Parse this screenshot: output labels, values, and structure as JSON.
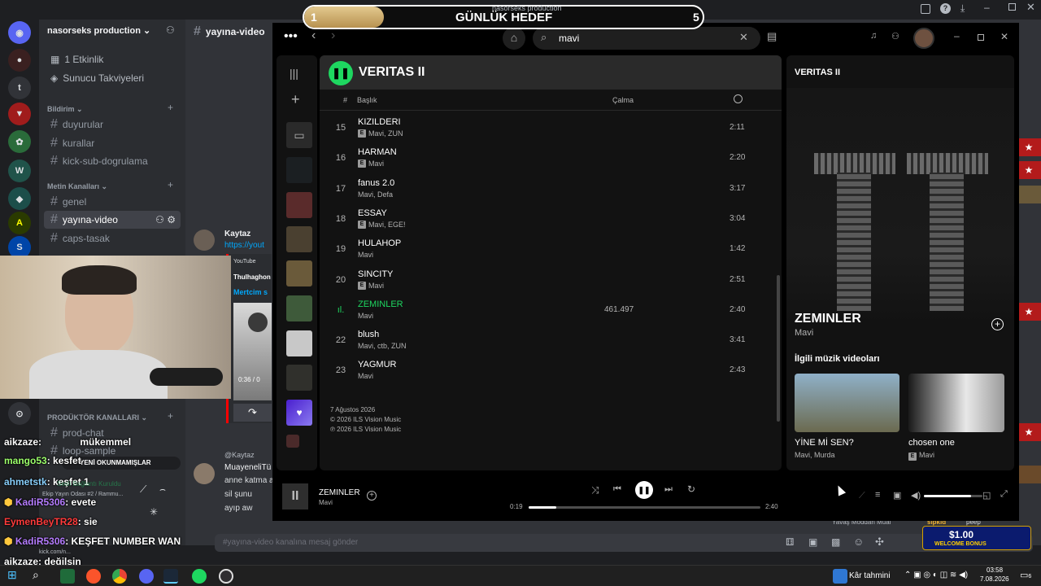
{
  "overlay": {
    "goal_title": "GÜNLÜK HEDEF",
    "goal_current": "1",
    "goal_target": "5",
    "goal_fraction": 0.2,
    "top_label": "nasorseks production"
  },
  "discord": {
    "server_name": "nasorseks production",
    "active_channel_header": "yayına-video",
    "events_label": "1 Etkinlik",
    "boosts_label": "Sunucu Takviyeleri",
    "categories": [
      "Bildirim",
      "Metin Kanalları",
      "PRODÜKTÖR KANALLARI"
    ],
    "channels": [
      "duyurular",
      "kurallar",
      "kick-sub-dogrulama",
      "genel",
      "yayına-video",
      "caps-tasak",
      "prod-chat",
      "loop-sample",
      "feedback"
    ],
    "message_author": "Kaytaz",
    "message_link": "https://yout",
    "embed_source": "YouTube",
    "embed_title": "Thulhaghon",
    "embed_sub": "Mertcim s",
    "video_time": "0:36 / 0",
    "reply_author": "@Kaytaz",
    "reply_author2": "MuayeneliTü",
    "msg_lines": [
      "anne katma a",
      "sil şunu",
      "ayıp aw"
    ],
    "unread_label": "YENİ OKUNMAMIŞLAR",
    "voice_label": "Ekip Yayın Odası #2 / Rammu...",
    "voice_status": "Sesli Bağlantı Kuruldu",
    "input_placeholder": "#yayına-video kanalına mesaj gönder",
    "bottom_status": "Yavaş Moddan Muaf",
    "bottom_user": "sipkid",
    "bottom_user2": "peep",
    "bonus_amount": "$1.00",
    "bonus_label": "WELCOME BONUS"
  },
  "chat": [
    {
      "user": "aikzaze",
      "text": ": ",
      "emote": "mükemmel",
      "color": "#ffffff"
    },
    {
      "user": "mango53",
      "text": ": kesfet",
      "color": "#9cff6b"
    },
    {
      "user": "ahmetstk",
      "text": ": keşfet 1",
      "color": "#87cefa"
    },
    {
      "user": "KadiR5306",
      "text": ": evete",
      "color": "#b57cff"
    },
    {
      "user": "EymenBeyTR28",
      "text": ": sie",
      "color": "#ff3b3b"
    },
    {
      "user": "KadiR5306",
      "text": ": KEŞFET NUMBER WAN",
      "color": "#b57cff"
    },
    {
      "user": "aikzaze",
      "text": ": değilsin",
      "color": "#ffffff"
    }
  ],
  "kick_label": "kick.com/n...",
  "spotify": {
    "search_value": "mavi",
    "playlist_title": "VERITAS II",
    "col_num": "#",
    "col_title": "Başlık",
    "col_plays": "Çalma",
    "tracks": [
      {
        "num": "15",
        "title": "KIZILDERI",
        "artists": "Mavi, ZUN",
        "explicit": true,
        "plays": "",
        "dur": "2:11"
      },
      {
        "num": "16",
        "title": "HARMAN",
        "artists": "Mavi",
        "explicit": true,
        "plays": "",
        "dur": "2:20"
      },
      {
        "num": "17",
        "title": "fanus 2.0",
        "artists": "Mavi, Defa",
        "explicit": false,
        "plays": "",
        "dur": "3:17"
      },
      {
        "num": "18",
        "title": "ESSAY",
        "artists": "Mavi, EGE!",
        "explicit": true,
        "plays": "",
        "dur": "3:04"
      },
      {
        "num": "19",
        "title": "HULAHOP",
        "artists": "Mavi",
        "explicit": false,
        "plays": "",
        "dur": "1:42"
      },
      {
        "num": "20",
        "title": "SINCITY",
        "artists": "Mavi",
        "explicit": true,
        "plays": "",
        "dur": "2:51"
      },
      {
        "num": "",
        "title": "ZEMINLER",
        "artists": "Mavi",
        "explicit": false,
        "plays": "461.497",
        "dur": "2:40",
        "active": true
      },
      {
        "num": "22",
        "title": "blush",
        "artists": "Mavi, ctb, ZUN",
        "explicit": false,
        "plays": "",
        "dur": "3:41"
      },
      {
        "num": "23",
        "title": "YAGMUR",
        "artists": "Mavi",
        "explicit": false,
        "plays": "",
        "dur": "2:43"
      }
    ],
    "release_date": "7 Ağustos 2026",
    "copyright1": "© 2026 ILS Vision Music",
    "copyright2": "℗ 2026 ILS Vision Music",
    "right_panel_title": "VERITAS II",
    "now_title": "ZEMINLER",
    "now_artist": "Mavi",
    "videos_heading": "İlgili müzik videoları",
    "videos": [
      {
        "title": "YİNE Mİ SEN?",
        "artists": "Mavi, Murda",
        "explicit": false
      },
      {
        "title": "chosen one",
        "artists": "Mavi",
        "explicit": true
      }
    ],
    "player": {
      "title": "ZEMINLER",
      "artist": "Mavi",
      "elapsed": "0:19",
      "total": "2:40",
      "progress": 0.12,
      "volume": 0.8
    }
  },
  "taskbar": {
    "weather": "Kâr tahmini",
    "time": "03:58",
    "date": "7.08.2026",
    "notif": "6"
  },
  "colors": {
    "spotify_green": "#1ed760",
    "discord_bg": "#313338"
  }
}
